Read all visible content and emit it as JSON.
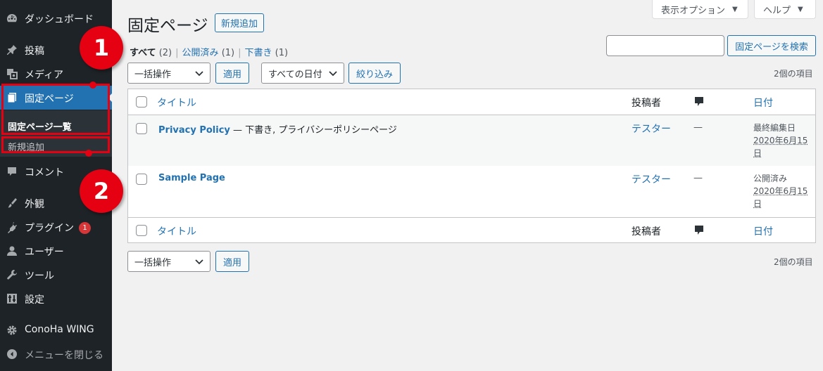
{
  "sidebar": {
    "items": [
      {
        "label": "ダッシュボード",
        "icon": "dashboard-icon"
      },
      {
        "label": "投稿",
        "icon": "pin-icon"
      },
      {
        "label": "メディア",
        "icon": "media-icon"
      },
      {
        "label": "固定ページ",
        "icon": "page-icon"
      },
      {
        "label": "コメント",
        "icon": "comment-icon"
      },
      {
        "label": "外観",
        "icon": "brush-icon"
      },
      {
        "label": "プラグイン",
        "icon": "plugin-icon",
        "badge": "1"
      },
      {
        "label": "ユーザー",
        "icon": "user-icon"
      },
      {
        "label": "ツール",
        "icon": "wrench-icon"
      },
      {
        "label": "設定",
        "icon": "settings-icon"
      },
      {
        "label": "ConoHa WING",
        "icon": "gear-icon"
      },
      {
        "label": "メニューを閉じる",
        "icon": "collapse-icon"
      }
    ],
    "submenu": [
      "固定ページ一覧",
      "新規追加"
    ]
  },
  "header": {
    "screen_options": "表示オプション",
    "help": "ヘルプ",
    "title": "固定ページ",
    "add_new": "新規追加"
  },
  "filters": {
    "all_label": "すべて",
    "all_count": "(2)",
    "published_label": "公開済み",
    "published_count": "(1)",
    "draft_label": "下書き",
    "draft_count": "(1)",
    "search_button": "固定ページを検索",
    "bulk_action": "一括操作",
    "apply": "適用",
    "all_dates": "すべての日付",
    "filter_button": "絞り込み",
    "items_count": "2個の項目"
  },
  "table": {
    "col_title": "タイトル",
    "col_author": "投稿者",
    "col_date": "日付",
    "rows": [
      {
        "title": "Privacy Policy",
        "state": " — 下書き, プライバシーポリシーページ",
        "author": "テスター",
        "comments": "—",
        "date_status": "最終編集日",
        "date": "2020年6月15日"
      },
      {
        "title": "Sample Page",
        "state": "",
        "author": "テスター",
        "comments": "—",
        "date_status": "公開済み",
        "date": "2020年6月15日"
      }
    ]
  },
  "annotations": {
    "callout_1": "1",
    "callout_2": "2",
    "color": "#e50012"
  },
  "colors": {
    "sidebar_bg": "#1d2327",
    "accent": "#2271b1",
    "badge": "#d63638"
  }
}
